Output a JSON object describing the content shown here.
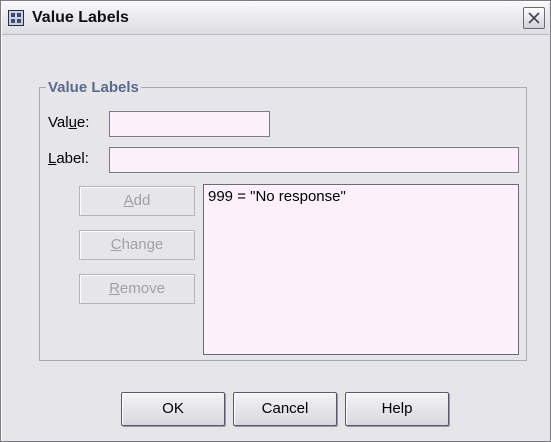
{
  "window": {
    "title": "Value Labels",
    "app_icon": "spreadsheet-icon",
    "close_icon": "close-icon"
  },
  "group": {
    "legend": "Value Labels"
  },
  "fields": {
    "value_label": "Value:",
    "value_mnemonic_pre": "Val",
    "value_mnemonic": "u",
    "value_mnemonic_post": "e:",
    "value_text": "",
    "label_mnemonic": "L",
    "label_rest": "abel:",
    "label_text": ""
  },
  "buttons": {
    "add": {
      "mnemonic": "A",
      "rest": "dd",
      "enabled": false
    },
    "change": {
      "mnemonic": "C",
      "rest": "hange",
      "enabled": false
    },
    "remove": {
      "mnemonic": "R",
      "rest": "emove",
      "enabled": false
    },
    "ok": "OK",
    "cancel": "Cancel",
    "help": "Help"
  },
  "list": {
    "items": [
      "999 = \"No response\""
    ]
  },
  "colors": {
    "field_bg": "#fbf0fb",
    "legend": "#5a6a8c",
    "disabled_text": "#a0a0a8"
  }
}
